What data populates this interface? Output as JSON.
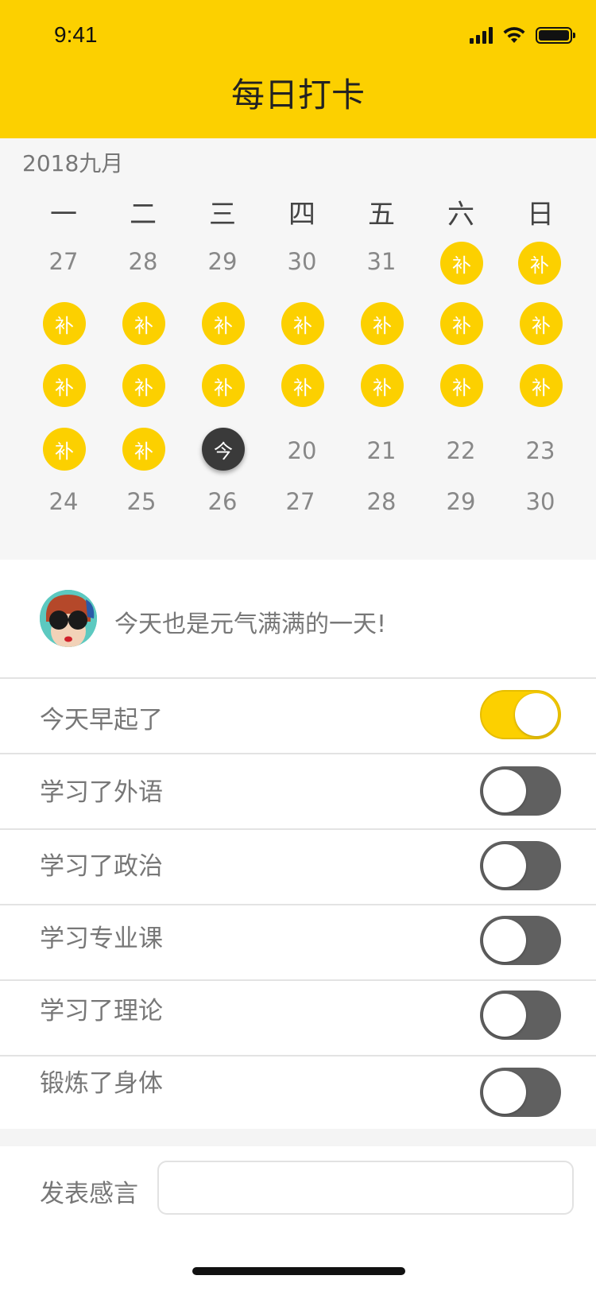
{
  "status_bar": {
    "time": "9:41"
  },
  "header": {
    "title": "每日打卡"
  },
  "calendar": {
    "month_label": "2018九月",
    "weekdays": [
      "一",
      "二",
      "三",
      "四",
      "五",
      "六",
      "日"
    ],
    "makeup_label": "补",
    "today_label": "今",
    "row1": [
      "27",
      "28",
      "29",
      "30",
      "31"
    ],
    "row4_nums": [
      "20",
      "21",
      "22",
      "23"
    ],
    "row5": [
      "24",
      "25",
      "26",
      "27",
      "28",
      "29",
      "30"
    ]
  },
  "motto": {
    "text": "今天也是元气满满的一天!"
  },
  "checklist": [
    {
      "label": "今天早起了",
      "on": true
    },
    {
      "label": "学习了外语",
      "on": false
    },
    {
      "label": "学习了政治",
      "on": false
    },
    {
      "label": "学习专业课",
      "on": false
    },
    {
      "label": "学习了理论",
      "on": false
    },
    {
      "label": "锻炼了身体",
      "on": false
    }
  ],
  "remark": {
    "label": "发表感言",
    "value": "",
    "placeholder": ""
  },
  "colors": {
    "accent": "#FCD000",
    "today": "#3a3a3a",
    "toggle_off": "#606060"
  }
}
